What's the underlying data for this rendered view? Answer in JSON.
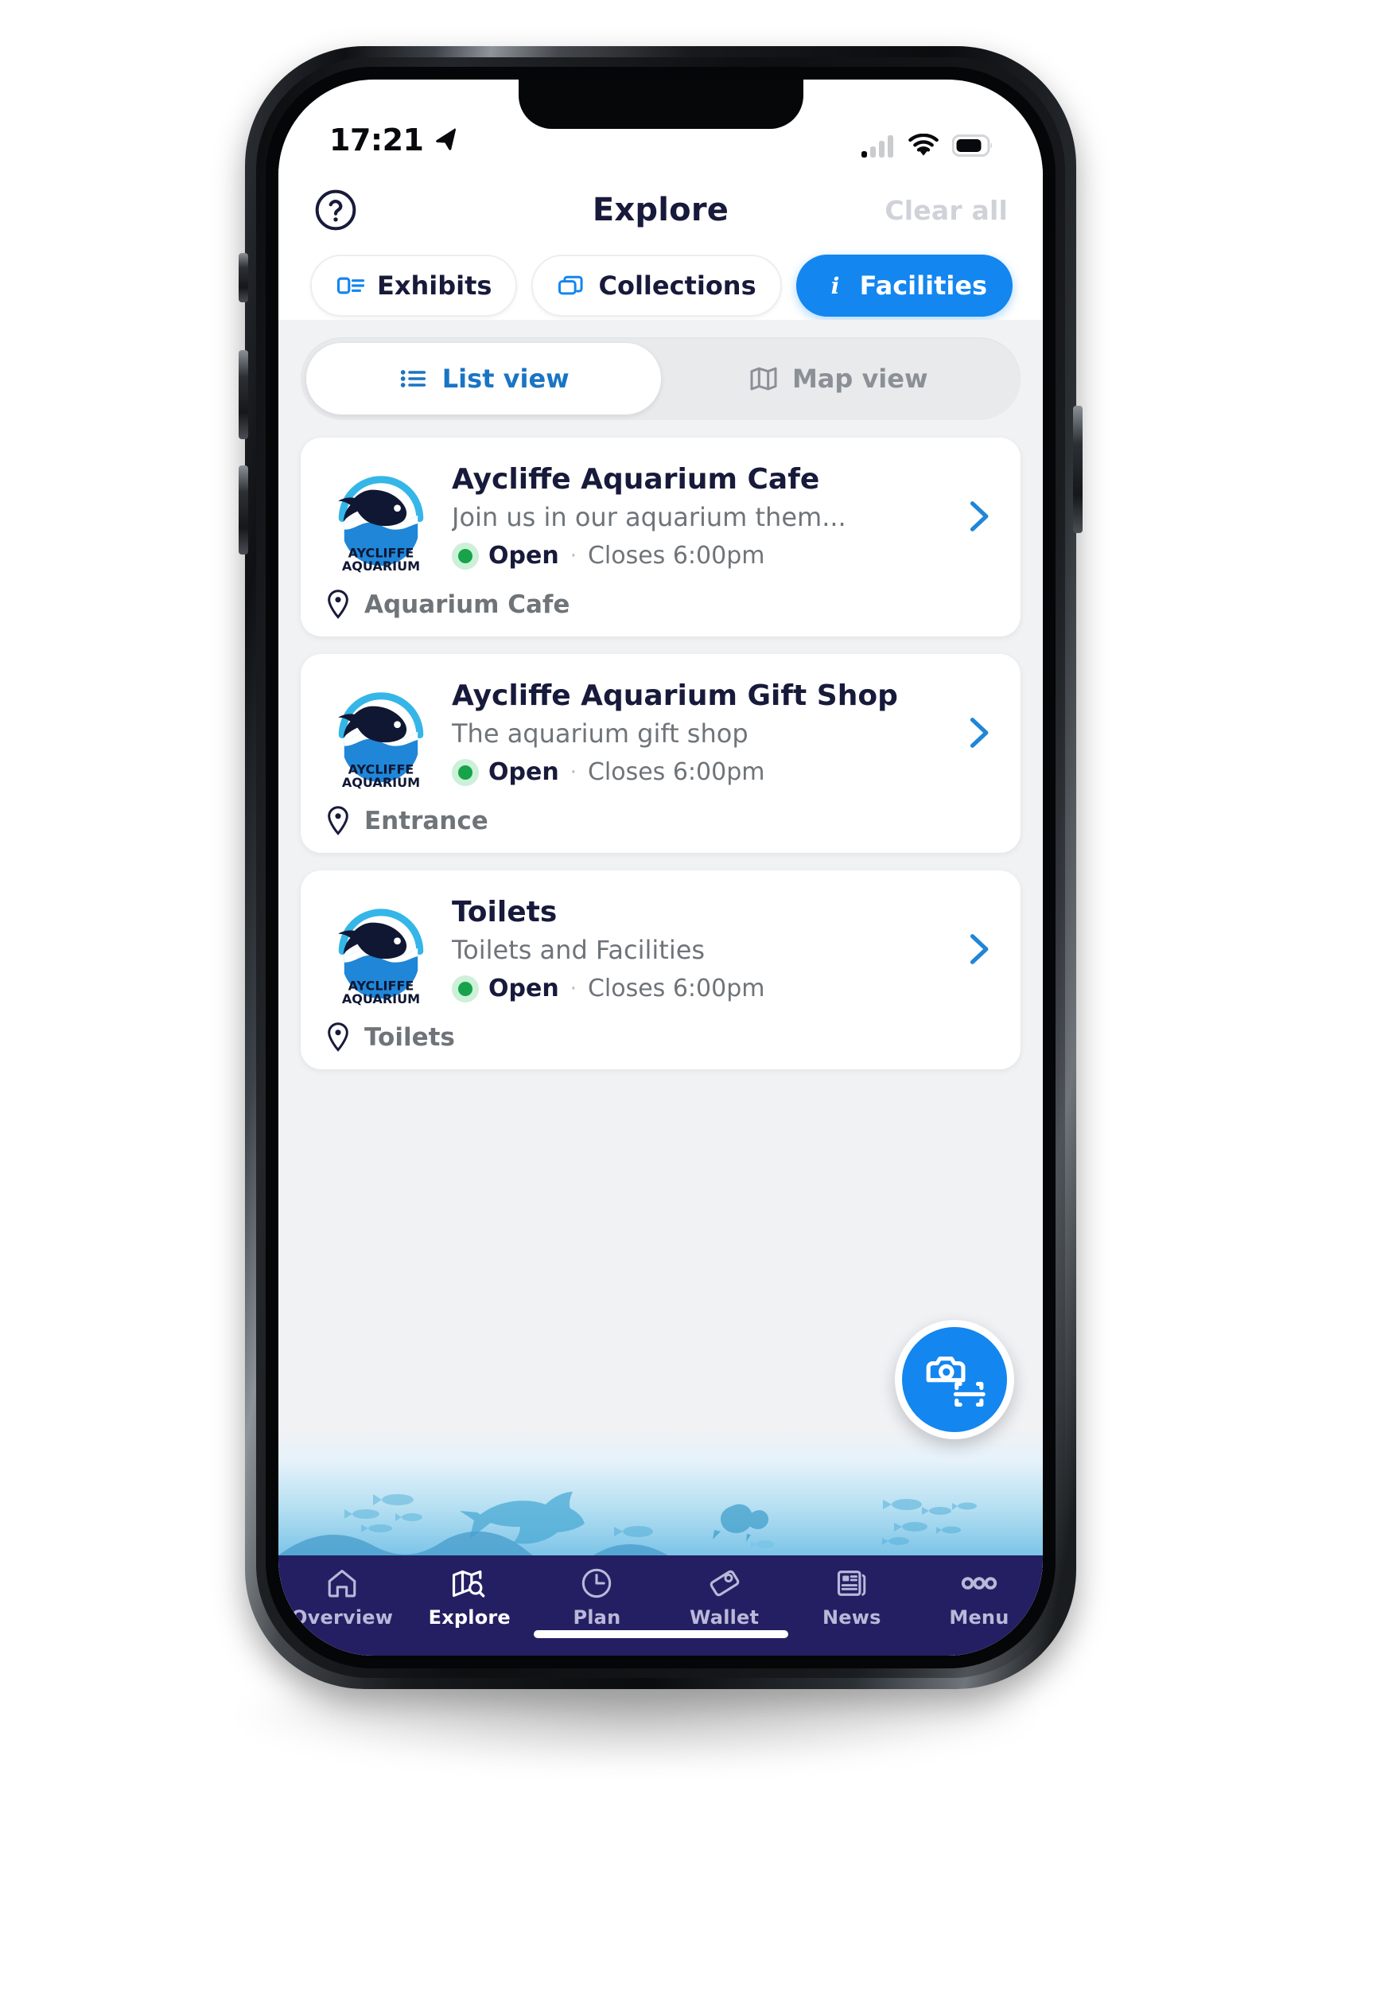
{
  "status_bar": {
    "time": "17:21",
    "location_icon": "location-arrow-icon",
    "cellular_icon": "cellular-signal-icon",
    "wifi_icon": "wifi-icon",
    "battery_icon": "battery-icon"
  },
  "header": {
    "help_icon": "question-mark-circle-icon",
    "title": "Explore",
    "clear_all_label": "Clear all"
  },
  "filters": [
    {
      "label": "Exhibits",
      "icon": "exhibits-list-icon",
      "active": false
    },
    {
      "label": "Collections",
      "icon": "collections-stack-icon",
      "active": false
    },
    {
      "label": "Facilities",
      "icon": "info-icon",
      "active": true
    }
  ],
  "view_toggle": [
    {
      "label": "List view",
      "icon": "bulleted-list-icon",
      "active": true
    },
    {
      "label": "Map view",
      "icon": "folded-map-icon",
      "active": false
    }
  ],
  "cards": [
    {
      "logo_icon": "aycliffe-aquarium-logo",
      "logo_text_line1": "AYCLIFFE",
      "logo_text_line2": "AQUARIUM",
      "title": "Aycliffe Aquarium Cafe",
      "description": "Join us in our aquarium them...",
      "status": "Open",
      "separator": "·",
      "hours": "Closes 6:00pm",
      "location": "Aquarium Cafe",
      "chevron_icon": "chevron-right-icon",
      "pin_icon": "map-pin-icon"
    },
    {
      "logo_icon": "aycliffe-aquarium-logo",
      "logo_text_line1": "AYCLIFFE",
      "logo_text_line2": "AQUARIUM",
      "title": "Aycliffe Aquarium Gift Shop",
      "description": "The aquarium gift shop",
      "status": "Open",
      "separator": "·",
      "hours": "Closes 6:00pm",
      "location": "Entrance",
      "chevron_icon": "chevron-right-icon",
      "pin_icon": "map-pin-icon"
    },
    {
      "logo_icon": "aycliffe-aquarium-logo",
      "logo_text_line1": "AYCLIFFE",
      "logo_text_line2": "AQUARIUM",
      "title": "Toilets",
      "description": "Toilets and Facilities",
      "status": "Open",
      "separator": "·",
      "hours": "Closes 6:00pm",
      "location": "Toilets",
      "chevron_icon": "chevron-right-icon",
      "pin_icon": "map-pin-icon"
    }
  ],
  "scan_button": {
    "icon": "camera-scan-icon"
  },
  "tabs": [
    {
      "label": "Overview",
      "icon": "home-icon",
      "active": false
    },
    {
      "label": "Explore",
      "icon": "map-search-icon",
      "active": true
    },
    {
      "label": "Plan",
      "icon": "clock-icon",
      "active": false
    },
    {
      "label": "Wallet",
      "icon": "ticket-icon",
      "active": false
    },
    {
      "label": "News",
      "icon": "newspaper-icon",
      "active": false
    },
    {
      "label": "Menu",
      "icon": "three-dots-icon",
      "active": false
    }
  ],
  "colors": {
    "accent_blue": "#1386f0",
    "navy": "#171a3a",
    "tabbar_navy": "#241f63",
    "status_green": "#16a34a",
    "muted_gray": "#6f7479",
    "page_bg": "#f1f2f4"
  }
}
